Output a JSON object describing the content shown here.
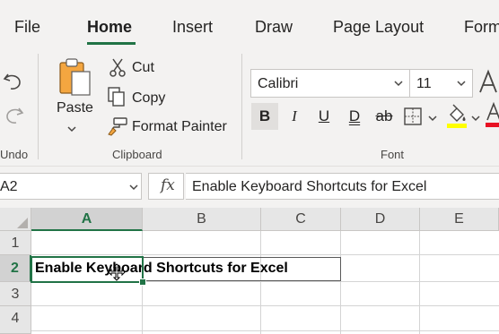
{
  "tabs": [
    {
      "label": "File"
    },
    {
      "label": "Home"
    },
    {
      "label": "Insert"
    },
    {
      "label": "Draw"
    },
    {
      "label": "Page Layout"
    },
    {
      "label": "Form"
    }
  ],
  "ribbon": {
    "undo": {
      "group_label": "Undo"
    },
    "clipboard": {
      "paste_label": "Paste",
      "cut_label": "Cut",
      "copy_label": "Copy",
      "format_painter_label": "Format Painter",
      "group_label": "Clipboard"
    },
    "font": {
      "font_name": "Calibri",
      "font_size": "11",
      "bold_glyph": "B",
      "italic_glyph": "I",
      "underline_glyph": "U",
      "double_underline_glyph": "D",
      "strikethrough_glyph": "ab",
      "group_label": "Font",
      "highlight_color": "#ffff00",
      "font_color": "#e81123"
    }
  },
  "formula_bar": {
    "name_box": "A2",
    "fx_label": "fx",
    "formula_value": "Enable Keyboard Shortcuts for Excel"
  },
  "grid": {
    "columns": [
      "A",
      "B",
      "C",
      "D",
      "E"
    ],
    "rows": [
      "1",
      "2",
      "3",
      "4"
    ],
    "selected_column": "A",
    "selected_row": "2",
    "cell_a2": "Enable Keyboard Shortcuts for Excel"
  },
  "colors": {
    "accent": "#217346",
    "background": "#f3f2f1"
  }
}
